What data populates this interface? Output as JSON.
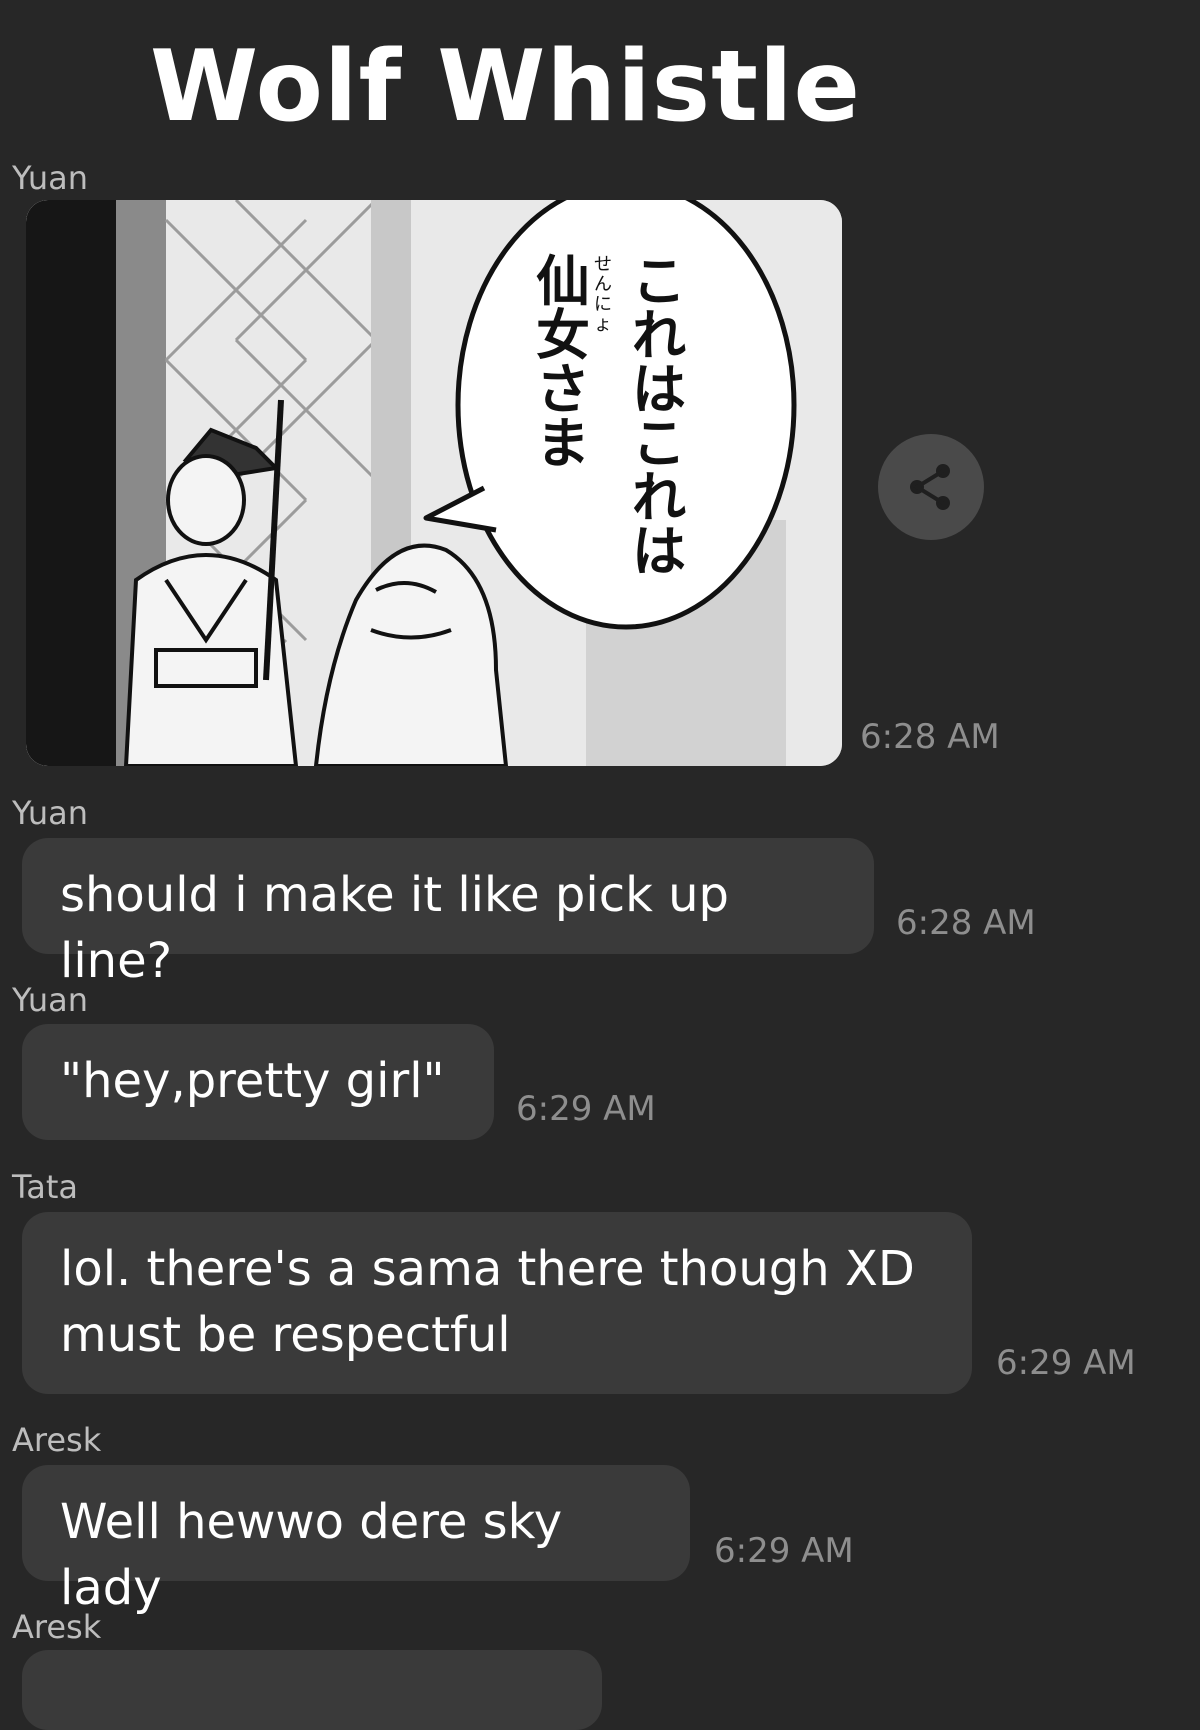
{
  "title": "Wolf Whistle",
  "messages": [
    {
      "sender": "Yuan",
      "type": "image",
      "image_text": "これはこれは仙女さま",
      "image_ruby": "せんにょ",
      "time": "6:28 AM"
    },
    {
      "sender": "Yuan",
      "type": "text",
      "text": "should i make it like pick up line?",
      "time": "6:28 AM"
    },
    {
      "sender": "Yuan",
      "type": "text",
      "text": "\"hey,pretty girl\"",
      "time": "6:29 AM"
    },
    {
      "sender": "Tata",
      "type": "text",
      "text": "lol. there's a sama there though XD\nmust be respectful",
      "time": "6:29 AM"
    },
    {
      "sender": "Aresk",
      "type": "text",
      "text": "Well hewwo dere sky lady",
      "time": "6:29 AM"
    },
    {
      "sender": "Aresk",
      "type": "text",
      "text": "",
      "time": ""
    }
  ],
  "icons": {
    "share": "share-icon"
  },
  "colors": {
    "background": "#272727",
    "bubble": "#3a3a3a",
    "timestamp": "#8e8e8e",
    "sender": "#bdbdbd"
  }
}
